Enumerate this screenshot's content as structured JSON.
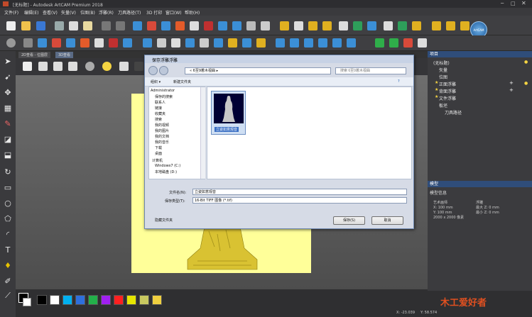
{
  "app": {
    "title": "[无标题] - Autodesk ArtCAM Premium 2018",
    "logo_text": "ArtCAM"
  },
  "menu": [
    "文件(F)",
    "编辑(E)",
    "查看(V)",
    "矢量(V)",
    "位图(B)",
    "浮雕(R)",
    "刀具路径(T)",
    "3D 打印",
    "窗口(W)",
    "帮助(H)"
  ],
  "view_tabs": [
    "2D查看 - 位图层",
    "3D查看"
  ],
  "project_panel": {
    "title": "项目",
    "tree": [
      "(无标题)",
      "矢量",
      "位图",
      "正面浮雕",
      "背面浮雕",
      "文件浮雕",
      "板坯",
      "刀具路径"
    ]
  },
  "models_panel": {
    "title": "模型",
    "subtitle": "模型信息",
    "left": [
      "艺术画师",
      "X: 100 mm",
      "Y: 100 mm",
      "2000 x 2000 像素"
    ],
    "right": [
      "浮雕",
      "最大 Z: 0 mm",
      "最小 Z: 0 mm"
    ]
  },
  "status": {
    "x": "X: -23.039",
    "y": "Y: 58.574"
  },
  "watermark": "木工爱好者",
  "palette": [
    "#000000",
    "#ffffff",
    "#00b0f0",
    "#2e6fdc",
    "#23b04a",
    "#a020f0",
    "#ff2020",
    "#e6e600",
    "#c8c860",
    "#f0d040"
  ],
  "dialog": {
    "title": "保存浮雕浮雕",
    "address": "« 6至9着木视曲 ▸",
    "search_placeholder": "搜索 6至9着木视曲",
    "organize": "组织 ▾",
    "new_folder": "新建文件夹",
    "nav": [
      "Administrator",
      "保存的搜索",
      "联系人",
      "链接",
      "收藏夹",
      "搜索",
      "我的视频",
      "我的图片",
      "我的文档",
      "我的音乐",
      "下载",
      "桌面",
      "计算机",
      "Windows7 (C:)",
      "本地磁盘 (D:)"
    ],
    "file_name": "立姿如意观音",
    "filename_label": "文件名(N):",
    "filename_value": "立姿如意观音",
    "type_label": "保存类型(T):",
    "type_value": "16-Bit TIFF 图像 (*.tif)",
    "hide_folders": "隐藏文件夹",
    "save": "保存(S)",
    "cancel": "取消"
  }
}
